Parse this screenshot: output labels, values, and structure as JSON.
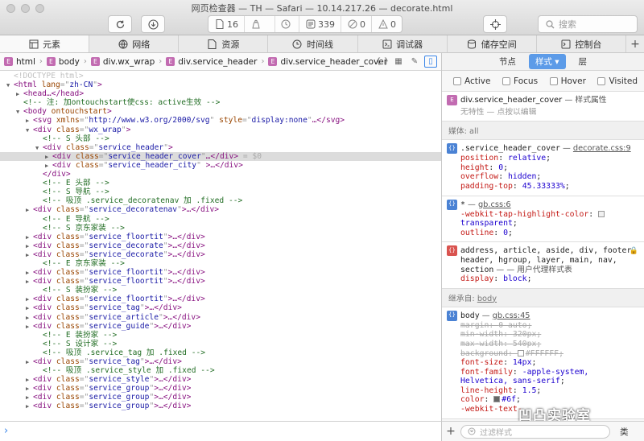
{
  "window": {
    "title": "网页检查器 — TH — Safari — 10.14.217.26 — decorate.html",
    "counter": {
      "pages": "16",
      "warnings": "0",
      "errors": "339",
      "logs": "0"
    },
    "search_placeholder": "搜索"
  },
  "tabs": [
    {
      "label": "元素",
      "icon": "elements-icon",
      "active": true
    },
    {
      "label": "网络",
      "icon": "network-icon",
      "active": false
    },
    {
      "label": "资源",
      "icon": "resources-icon",
      "active": false
    },
    {
      "label": "时间线",
      "icon": "timeline-icon",
      "active": false
    },
    {
      "label": "调试器",
      "icon": "debugger-icon",
      "active": false
    },
    {
      "label": "储存空间",
      "icon": "storage-icon",
      "active": false
    },
    {
      "label": "控制台",
      "icon": "console-icon",
      "active": false
    }
  ],
  "breadcrumb": [
    "html",
    "body",
    "div.wx_wrap",
    "div.service_header",
    "div.service_header_cover"
  ],
  "tree": [
    {
      "d": 0,
      "k": "doctype",
      "t": "<!DOCTYPE html>"
    },
    {
      "d": 0,
      "k": "open",
      "tw": "down",
      "tag": "html",
      "attrs": [
        [
          "lang",
          "zh-CN"
        ]
      ]
    },
    {
      "d": 1,
      "k": "open",
      "tw": "right",
      "tag": "head",
      "tail": "…</head>"
    },
    {
      "d": 1,
      "k": "comment",
      "t": "<!-- 注: 加ontouchstart使css: active生效 -->"
    },
    {
      "d": 1,
      "k": "open",
      "tw": "down",
      "tag": "body",
      "attrs": [
        [
          "ontouchstart",
          null
        ]
      ]
    },
    {
      "d": 2,
      "k": "open",
      "tw": "right",
      "tag": "svg",
      "attrs": [
        [
          "xmlns",
          "http://www.w3.org/2000/svg"
        ],
        [
          "style",
          "display:none"
        ]
      ],
      "tail": "…</svg>"
    },
    {
      "d": 2,
      "k": "open",
      "tw": "down",
      "tag": "div",
      "attrs": [
        [
          "class",
          "wx_wrap"
        ]
      ]
    },
    {
      "d": 3,
      "k": "comment",
      "t": "<!-- S 头部 -->"
    },
    {
      "d": 3,
      "k": "open",
      "tw": "down",
      "tag": "div",
      "attrs": [
        [
          "class",
          "service_header"
        ]
      ]
    },
    {
      "d": 4,
      "k": "open",
      "tw": "right",
      "tag": "div",
      "attrs": [
        [
          "class",
          "service_header_cover"
        ]
      ],
      "tail": "…</div>",
      "marker": " = $0",
      "sel": true
    },
    {
      "d": 4,
      "k": "open",
      "tw": "right",
      "tag": "div",
      "attrs": [
        [
          "class",
          "service_header_city"
        ]
      ],
      "tail": " >…</div>"
    },
    {
      "d": 3,
      "k": "close",
      "t": "</div>"
    },
    {
      "d": 3,
      "k": "comment",
      "t": "<!-- E 头部 -->"
    },
    {
      "d": 3,
      "k": "comment",
      "t": "<!-- S 导航 -->"
    },
    {
      "d": 3,
      "k": "comment",
      "t": "<!-- 吸顶 .service_decoratenav 加 .fixed -->"
    },
    {
      "d": 2,
      "k": "open",
      "tw": "right",
      "tag": "div",
      "attrs": [
        [
          "class",
          "service_decoratenav"
        ]
      ],
      "tail": ">…</div>"
    },
    {
      "d": 3,
      "k": "comment",
      "t": "<!-- E 导航 -->"
    },
    {
      "d": 3,
      "k": "comment",
      "t": "<!-- S 京东家装 -->"
    },
    {
      "d": 2,
      "k": "open",
      "tw": "right",
      "tag": "div",
      "attrs": [
        [
          "class",
          "service_floortit"
        ]
      ],
      "tail": ">…</div>"
    },
    {
      "d": 2,
      "k": "open",
      "tw": "right",
      "tag": "div",
      "attrs": [
        [
          "class",
          "service_decorate"
        ]
      ],
      "tail": ">…</div>"
    },
    {
      "d": 2,
      "k": "open",
      "tw": "right",
      "tag": "div",
      "attrs": [
        [
          "class",
          "service_decorate"
        ]
      ],
      "tail": ">…</div>"
    },
    {
      "d": 3,
      "k": "comment",
      "t": "<!-- E 京东家装 -->"
    },
    {
      "d": 2,
      "k": "open",
      "tw": "right",
      "tag": "div",
      "attrs": [
        [
          "class",
          "service_floortit"
        ]
      ],
      "tail": ">…</div>"
    },
    {
      "d": 2,
      "k": "open",
      "tw": "right",
      "tag": "div",
      "attrs": [
        [
          "class",
          "service_floortit"
        ]
      ],
      "tail": ">…</div>"
    },
    {
      "d": 3,
      "k": "comment",
      "t": "<!-- S 装扮家 -->"
    },
    {
      "d": 2,
      "k": "open",
      "tw": "right",
      "tag": "div",
      "attrs": [
        [
          "class",
          "service_floortit"
        ]
      ],
      "tail": ">…</div>"
    },
    {
      "d": 2,
      "k": "open",
      "tw": "right",
      "tag": "div",
      "attrs": [
        [
          "class",
          "service_tag"
        ]
      ],
      "tail": ">…</div>"
    },
    {
      "d": 2,
      "k": "open",
      "tw": "right",
      "tag": "div",
      "attrs": [
        [
          "class",
          "service_article"
        ]
      ],
      "tail": ">…</div>"
    },
    {
      "d": 2,
      "k": "open",
      "tw": "right",
      "tag": "div",
      "attrs": [
        [
          "class",
          "service_guide"
        ]
      ],
      "tail": ">…</div>"
    },
    {
      "d": 3,
      "k": "comment",
      "t": "<!-- E 装扮家 -->"
    },
    {
      "d": 3,
      "k": "comment",
      "t": "<!-- S 设计家 -->"
    },
    {
      "d": 3,
      "k": "comment",
      "t": "<!-- 吸顶 .service_tag 加 .fixed -->"
    },
    {
      "d": 2,
      "k": "open",
      "tw": "right",
      "tag": "div",
      "attrs": [
        [
          "class",
          "service_tag"
        ]
      ],
      "tail": ">…</div>"
    },
    {
      "d": 3,
      "k": "comment",
      "t": "<!-- 吸顶 .service_style 加 .fixed -->"
    },
    {
      "d": 2,
      "k": "open",
      "tw": "right",
      "tag": "div",
      "attrs": [
        [
          "class",
          "service_style"
        ]
      ],
      "tail": ">…</div>"
    },
    {
      "d": 2,
      "k": "open",
      "tw": "right",
      "tag": "div",
      "attrs": [
        [
          "class",
          "service_group"
        ]
      ],
      "tail": ">…</div>"
    },
    {
      "d": 2,
      "k": "open",
      "tw": "right",
      "tag": "div",
      "attrs": [
        [
          "class",
          "service_group"
        ]
      ],
      "tail": ">…</div>"
    },
    {
      "d": 2,
      "k": "open",
      "tw": "right",
      "tag": "div",
      "attrs": [
        [
          "class",
          "service_group"
        ]
      ],
      "tail": ">…</div>"
    }
  ],
  "sidebar": {
    "tabs": [
      {
        "label": "节点",
        "active": false
      },
      {
        "label": "样式",
        "active": true,
        "caret": "▾"
      },
      {
        "label": "层",
        "active": false
      }
    ],
    "pseudo": [
      "Active",
      "Focus",
      "Hover",
      "Visited"
    ],
    "element_rule": {
      "selector": "div.service_header_cover",
      "suffix": "— 样式属性",
      "note": "无特性 — 点按以编辑"
    },
    "media_label": "媒体: all",
    "rules": [
      {
        "badge": "{}",
        "color": "blue",
        "selector": ".service_header_cover",
        "source": "decorate.css:9",
        "decls": [
          [
            "position",
            "relative"
          ],
          [
            "height",
            "0"
          ],
          [
            "overflow",
            "hidden"
          ],
          [
            "padding-top",
            "45.33333%"
          ]
        ]
      },
      {
        "badge": "{}",
        "color": "blue",
        "selector": "*",
        "source": "gb.css:6",
        "decls": [
          [
            "-webkit-tap-highlight-color",
            "",
            "swatch"
          ],
          [
            "",
            "transparent",
            "cont"
          ],
          [
            "outline",
            "0"
          ]
        ]
      },
      {
        "badge": "{}",
        "color": "red",
        "selector": "address, article, aside, div, footer, header, hgroup, layer, main, nav, section",
        "source": "— 用户代理样式表",
        "locked": true,
        "decls": [
          [
            "display",
            "block"
          ]
        ]
      }
    ],
    "inherited_label": "继承自:",
    "inherited_from": "body",
    "body_rule": {
      "selector": "body",
      "source": "gb.css:45",
      "decls": [
        [
          "margin",
          "0 auto",
          "struck"
        ],
        [
          "min-width",
          "320px",
          "struck"
        ],
        [
          "max-width",
          "540px",
          "struck"
        ],
        [
          "background",
          "#FFFFFF",
          "struck-swatch"
        ],
        [
          "font-size",
          "14px"
        ],
        [
          "font-family",
          "-apple-system,",
          "open"
        ],
        [
          "",
          "Helvetica, sans-serif",
          "cont"
        ],
        [
          "line-height",
          "1.5"
        ],
        [
          "color",
          "#6f",
          "swatch-dark"
        ],
        [
          "-webkit-text-",
          "",
          "cut"
        ]
      ]
    },
    "filter_placeholder": "过滤样式",
    "class_toggle": "类"
  },
  "watermark": "凹凸实验室"
}
